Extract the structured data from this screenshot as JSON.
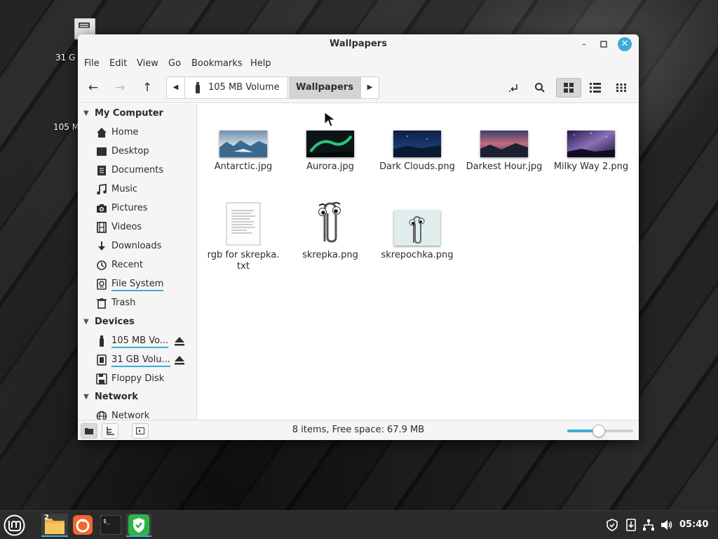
{
  "desktop": {
    "icons": [
      {
        "label": "31 G"
      },
      {
        "label": "105 M"
      }
    ]
  },
  "window": {
    "title": "Wallpapers",
    "menu": [
      "File",
      "Edit",
      "View",
      "Go",
      "Bookmarks",
      "Help"
    ],
    "pathbar": {
      "volume": "105 MB Volume",
      "current": "Wallpapers"
    },
    "sidebar": {
      "sections": {
        "my_computer": "My Computer",
        "devices": "Devices",
        "network": "Network"
      },
      "my_computer_items": [
        "Home",
        "Desktop",
        "Documents",
        "Music",
        "Pictures",
        "Videos",
        "Downloads",
        "Recent",
        "File System",
        "Trash"
      ],
      "device_items": [
        "105 MB Vo...",
        "31 GB Volu...",
        "Floppy Disk"
      ],
      "network_items": [
        "Network"
      ]
    },
    "files": [
      {
        "name": "Antarctic.jpg",
        "kind": "image"
      },
      {
        "name": "Aurora.jpg",
        "kind": "image"
      },
      {
        "name": "Dark Clouds.png",
        "kind": "image"
      },
      {
        "name": "Darkest Hour.jpg",
        "kind": "image"
      },
      {
        "name": "Milky Way 2.png",
        "kind": "image"
      },
      {
        "name": "rgb for skrepka.\ntxt",
        "kind": "text"
      },
      {
        "name": "skrepka.png",
        "kind": "image"
      },
      {
        "name": "skrepochka.png",
        "kind": "image"
      }
    ],
    "status": "8 items, Free space: 67.9 MB",
    "zoom_level": 0.48
  },
  "taskbar": {
    "file_manager_badge": "2",
    "clock": "05:40"
  },
  "colors": {
    "accent": "#3eabdb"
  }
}
